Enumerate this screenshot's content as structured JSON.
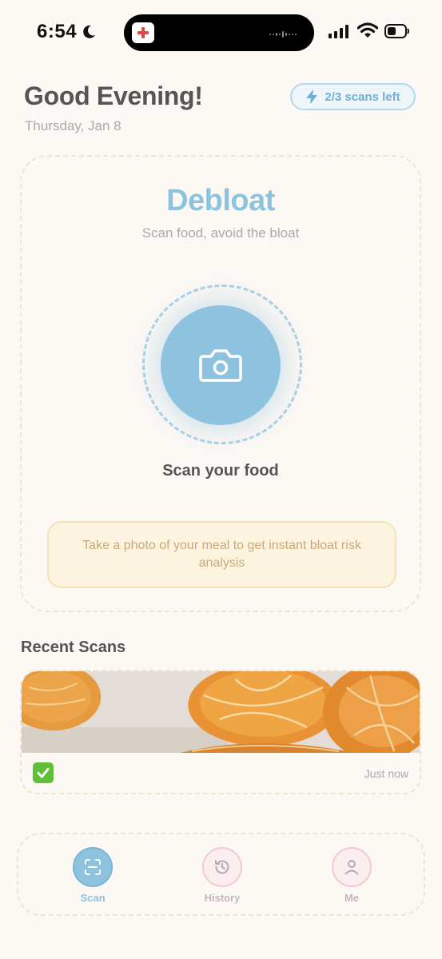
{
  "status_bar": {
    "time": "6:54"
  },
  "header": {
    "greeting": "Good Evening!",
    "date": "Thursday, Jan 8",
    "scans_left": "2/3 scans left"
  },
  "hero": {
    "title": "Debloat",
    "subtitle": "Scan food, avoid the bloat",
    "scan_label": "Scan your food",
    "tip": "Take a photo of your meal to get instant bloat risk analysis"
  },
  "recent": {
    "title": "Recent Scans",
    "items": [
      {
        "status_icon": "check-mark-icon",
        "time": "Just now"
      }
    ]
  },
  "tab_bar": {
    "tabs": [
      {
        "label": "Scan",
        "icon": "scan-icon",
        "active": true
      },
      {
        "label": "History",
        "icon": "history-icon",
        "active": false
      },
      {
        "label": "Me",
        "icon": "person-icon",
        "active": false
      }
    ]
  },
  "colors": {
    "accent": "#8ec3e0",
    "background": "#fcf8f4",
    "tip_background": "#fcf4df",
    "success": "#5fbf3a"
  }
}
